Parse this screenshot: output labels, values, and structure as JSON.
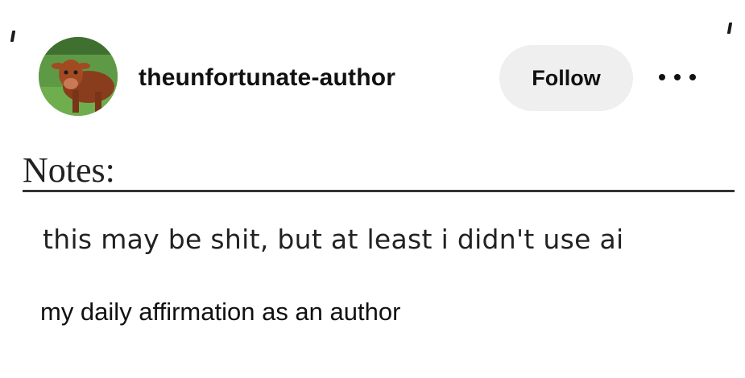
{
  "post": {
    "author": {
      "username": "theunfortunate-author",
      "avatar": "avatar-cow-in-field"
    },
    "follow_label": "Follow",
    "more_icon": "ellipsis-icon",
    "notes_heading": "Notes:",
    "quote": "this may be shit, but at least i didn't use ai",
    "caption": "my daily affirmation as an author"
  },
  "colors": {
    "follow_button_bg": "#efefef",
    "text": "#111111"
  }
}
